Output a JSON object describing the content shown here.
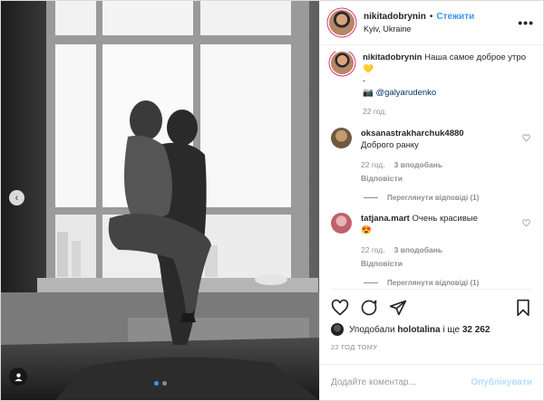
{
  "post": {
    "author": "nikitadobrynin",
    "separator": "•",
    "follow_label": "Стежити",
    "location": "Kyiv, Ukraine",
    "more_label": "•••"
  },
  "caption": {
    "username": "nikitadobrynin",
    "text": "Наша самое доброе утро 💛",
    "line2": "-",
    "camera": "📷",
    "mention": "@galyarudenko",
    "time": "22 год."
  },
  "comments": [
    {
      "username": "oksanastrakharchuk4880",
      "text": "Доброго ранку",
      "time": "22 год.",
      "likes": "3 вподобань",
      "reply": "Відповісти",
      "view_replies": "Переглянути відповіді (1)"
    },
    {
      "username": "tatjana.mart",
      "text": "Очень красивые",
      "emoji": "😍",
      "time": "22 год.",
      "likes": "3 вподобань",
      "reply": "Відповісти",
      "view_replies": "Переглянути відповіді (1)"
    }
  ],
  "likes": {
    "prefix": "Уподобали",
    "user": "holotalina",
    "middle": "і ще",
    "count": "32 262"
  },
  "timestamp": "22 ГОД ТОМУ",
  "add_comment": {
    "placeholder": "Додайте коментар...",
    "publish_label": "Опублікувати"
  },
  "carousel": {
    "prev_icon": "‹",
    "slides": 2,
    "active": 1
  },
  "colors": {
    "accent": "#3897f0",
    "publish_disabled": "#b2dffc",
    "muted": "#8e8e8e"
  }
}
